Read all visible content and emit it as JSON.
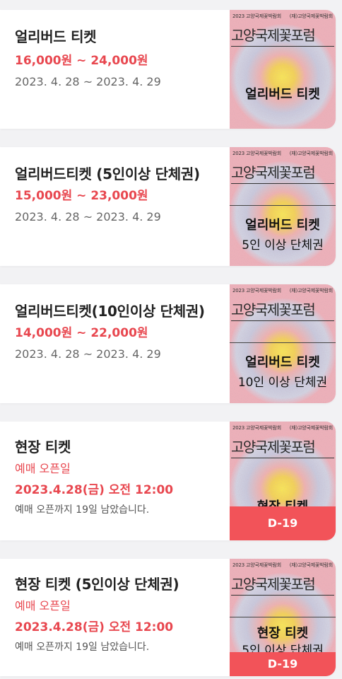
{
  "poster": {
    "header_left": "2023 고양국제꽃박람회",
    "header_right": "(재)고양국제꽃박람회",
    "logo_text": "고양국제꽃포럼"
  },
  "tickets": [
    {
      "title": "얼리버드 티켓",
      "price": "16,000원 ~ 24,000원",
      "dates": "2023. 4. 28 ~ 2023. 4. 29",
      "poster_caption": "얼리버드 티켓",
      "poster_sub": ""
    },
    {
      "title": "얼리버드티켓 (5인이상 단체권)",
      "price": "15,000원 ~ 23,000원",
      "dates": "2023. 4. 28 ~ 2023. 4. 29",
      "poster_caption": "얼리버드 티켓",
      "poster_sub": "5인 이상 단체권"
    },
    {
      "title": "얼리버드티켓(10인이상 단체권)",
      "price": "14,000원 ~ 22,000원",
      "dates": "2023. 4. 28 ~ 2023. 4. 29",
      "poster_caption": "얼리버드 티켓",
      "poster_sub": "10인 이상 단체권"
    },
    {
      "title": "현장 티켓",
      "open_label": "예매 오픈일",
      "open_date": "2023.4.28(금) 오전 12:00",
      "countdown": "예매 오픈까지 19일 남았습니다.",
      "poster_caption": "현장 티켓",
      "poster_sub": "",
      "badge": "D-19"
    },
    {
      "title": "현장 티켓 (5인이상 단체권)",
      "open_label": "예매 오픈일",
      "open_date": "2023.4.28(금) 오전 12:00",
      "countdown": "예매 오픈까지 19일 남았습니다.",
      "poster_caption": "현장 티켓",
      "poster_sub": "5인 이상 단체권",
      "badge": "D-19"
    }
  ],
  "colors": {
    "accent": "#e8474f",
    "badge": "#f25359",
    "background": "#f2f2f4",
    "card": "#ffffff"
  }
}
